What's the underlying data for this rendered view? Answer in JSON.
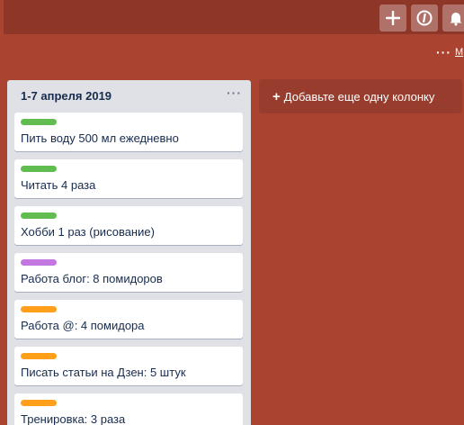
{
  "colors": {
    "board_background": "#ab4331",
    "header_background": "#8e3628",
    "list_background": "#dfe1e6",
    "label_green": "#61bd4f",
    "label_purple": "#c377e0",
    "label_orange": "#ff9f1a"
  },
  "header": {
    "buttons": [
      {
        "icon": "plus-icon",
        "glyph": "+"
      },
      {
        "icon": "info-icon",
        "glyph": "i"
      },
      {
        "icon": "bell-icon",
        "glyph": "bell"
      }
    ]
  },
  "board_header": {
    "menu_dots": "···",
    "menu_link": "М"
  },
  "list": {
    "title": "1-7 апреля 2019",
    "menu": "···",
    "cards": [
      {
        "label_color": "#61bd4f",
        "title": "Пить воду 500 мл ежедневно"
      },
      {
        "label_color": "#61bd4f",
        "title": "Читать 4 раза"
      },
      {
        "label_color": "#61bd4f",
        "title": "Хобби 1 раз (рисование)"
      },
      {
        "label_color": "#c377e0",
        "title": "Работа блог: 8 помидоров"
      },
      {
        "label_color": "#ff9f1a",
        "title": "Работа @: 4 помидора"
      },
      {
        "label_color": "#ff9f1a",
        "title": "Писать статьи на Дзен: 5 штук"
      },
      {
        "label_color": "#ff9f1a",
        "title": "Тренировка: 3 раза"
      }
    ]
  },
  "add_list": {
    "plus": "+",
    "label": "Добавьте еще одну колонку"
  }
}
